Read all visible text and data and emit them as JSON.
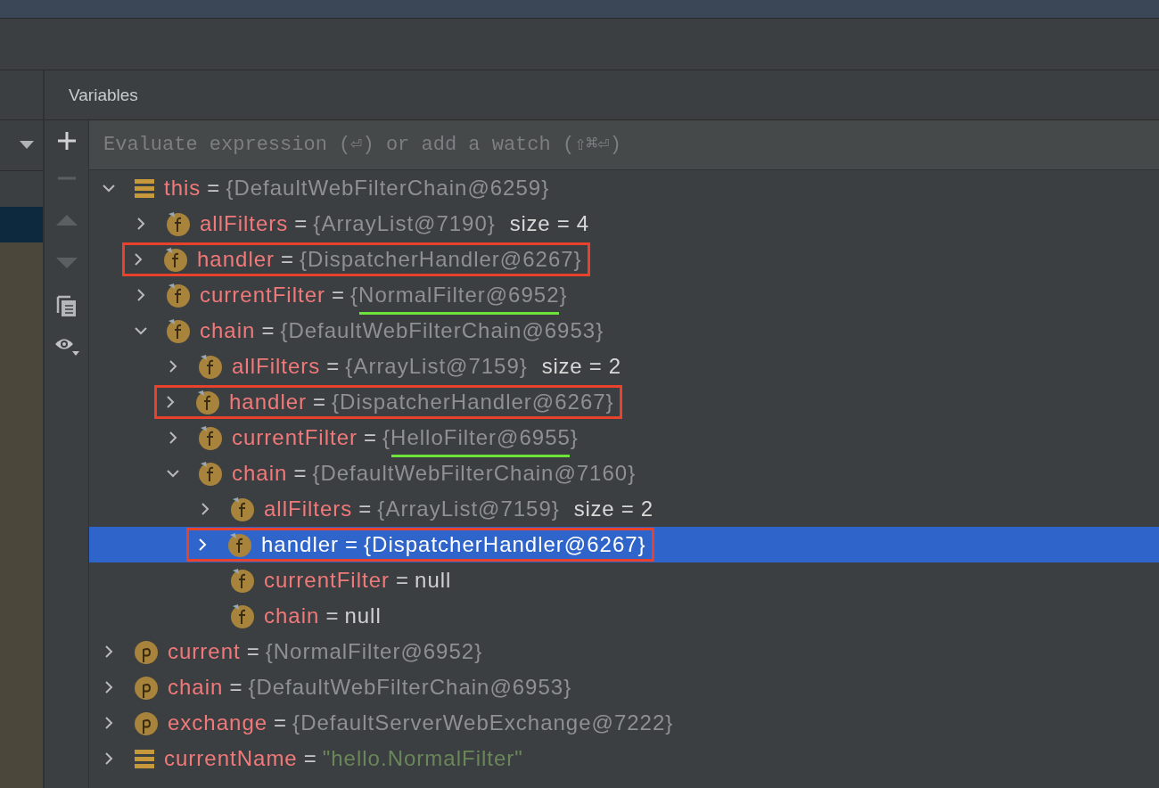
{
  "panel": {
    "title": "Variables"
  },
  "evaluate": {
    "placeholder": "Evaluate expression (⏎) or add a watch (⇧⌘⏎)"
  },
  "tree": [
    {
      "name": "this",
      "kind": "static",
      "expanded": true,
      "operator": "=",
      "value": "{DefaultWebFilterChain@6259}",
      "is_string": false,
      "is_null": false,
      "selected": false,
      "boxed": false,
      "underlined": false,
      "children": [
        {
          "name": "allFilters",
          "kind": "field",
          "expanded": false,
          "operator": "=",
          "value": "{ArrayList@7190}",
          "is_string": false,
          "is_null": false,
          "extra": "size = 4",
          "selected": false,
          "boxed": false,
          "underlined": false
        },
        {
          "name": "handler",
          "kind": "field",
          "expanded": false,
          "operator": "=",
          "value": "{DispatcherHandler@6267}",
          "is_string": false,
          "is_null": false,
          "selected": false,
          "boxed": true,
          "underlined": false
        },
        {
          "name": "currentFilter",
          "kind": "field",
          "expanded": false,
          "operator": "=",
          "value": "{NormalFilter@6952}",
          "is_string": false,
          "is_null": false,
          "selected": false,
          "boxed": false,
          "underlined": true
        },
        {
          "name": "chain",
          "kind": "field",
          "expanded": true,
          "operator": "=",
          "value": "{DefaultWebFilterChain@6953}",
          "is_string": false,
          "is_null": false,
          "selected": false,
          "boxed": false,
          "underlined": false,
          "children": [
            {
              "name": "allFilters",
              "kind": "field",
              "expanded": false,
              "operator": "=",
              "value": "{ArrayList@7159}",
              "is_string": false,
              "is_null": false,
              "extra": "size = 2",
              "selected": false,
              "boxed": false,
              "underlined": false
            },
            {
              "name": "handler",
              "kind": "field",
              "expanded": false,
              "operator": "=",
              "value": "{DispatcherHandler@6267}",
              "is_string": false,
              "is_null": false,
              "selected": false,
              "boxed": true,
              "underlined": false
            },
            {
              "name": "currentFilter",
              "kind": "field",
              "expanded": false,
              "operator": "=",
              "value": "{HelloFilter@6955}",
              "is_string": false,
              "is_null": false,
              "selected": false,
              "boxed": false,
              "underlined": true
            },
            {
              "name": "chain",
              "kind": "field",
              "expanded": true,
              "operator": "=",
              "value": "{DefaultWebFilterChain@7160}",
              "is_string": false,
              "is_null": false,
              "selected": false,
              "boxed": false,
              "underlined": false,
              "children": [
                {
                  "name": "allFilters",
                  "kind": "field",
                  "expanded": false,
                  "operator": "=",
                  "value": "{ArrayList@7159}",
                  "is_string": false,
                  "is_null": false,
                  "extra": "size = 2",
                  "selected": false,
                  "boxed": false,
                  "underlined": false
                },
                {
                  "name": "handler",
                  "kind": "field",
                  "expanded": false,
                  "operator": "=",
                  "value": "{DispatcherHandler@6267}",
                  "is_string": false,
                  "is_null": false,
                  "selected": true,
                  "boxed": true,
                  "underlined": false
                },
                {
                  "name": "currentFilter",
                  "kind": "field",
                  "operator": "=",
                  "value": "null",
                  "is_string": false,
                  "is_null": true,
                  "selected": false,
                  "boxed": false,
                  "underlined": false
                },
                {
                  "name": "chain",
                  "kind": "field",
                  "operator": "=",
                  "value": "null",
                  "is_string": false,
                  "is_null": true,
                  "selected": false,
                  "boxed": false,
                  "underlined": false
                }
              ]
            }
          ]
        }
      ]
    },
    {
      "name": "current",
      "kind": "param",
      "expanded": false,
      "operator": "=",
      "value": "{NormalFilter@6952}",
      "is_string": false,
      "is_null": false,
      "selected": false,
      "boxed": false,
      "underlined": false
    },
    {
      "name": "chain",
      "kind": "param",
      "expanded": false,
      "operator": "=",
      "value": "{DefaultWebFilterChain@6953}",
      "is_string": false,
      "is_null": false,
      "selected": false,
      "boxed": false,
      "underlined": false
    },
    {
      "name": "exchange",
      "kind": "param",
      "expanded": false,
      "operator": "=",
      "value": "{DefaultServerWebExchange@7222}",
      "is_string": false,
      "is_null": false,
      "selected": false,
      "boxed": false,
      "underlined": false
    },
    {
      "name": "currentName",
      "kind": "static",
      "expanded": false,
      "operator": "=",
      "value": "\"hello.NormalFilter\"",
      "is_string": true,
      "is_null": false,
      "selected": false,
      "boxed": false,
      "underlined": false
    }
  ]
}
